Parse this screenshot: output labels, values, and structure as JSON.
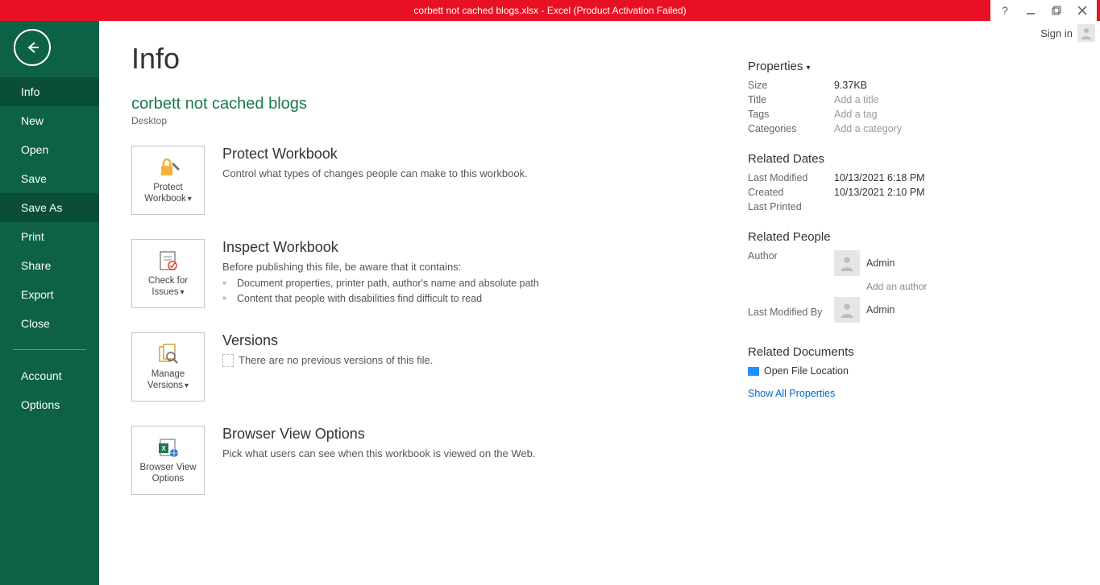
{
  "titlebar": {
    "title": "corbett not cached blogs.xlsx -  Excel (Product Activation Failed)"
  },
  "signin": {
    "label": "Sign in"
  },
  "sidebar": {
    "items": [
      "Info",
      "New",
      "Open",
      "Save",
      "Save As",
      "Print",
      "Share",
      "Export",
      "Close"
    ],
    "extra": [
      "Account",
      "Options"
    ]
  },
  "page": {
    "heading": "Info",
    "docname": "corbett not cached blogs",
    "doclocation": "Desktop"
  },
  "tiles": {
    "protect": {
      "label": "Protect Workbook"
    },
    "check": {
      "label": "Check for Issues"
    },
    "manage": {
      "label": "Manage Versions"
    },
    "browser": {
      "label": "Browser View Options"
    }
  },
  "sections": {
    "protect": {
      "title": "Protect Workbook",
      "desc": "Control what types of changes people can make to this workbook."
    },
    "inspect": {
      "title": "Inspect Workbook",
      "desc": "Before publishing this file, be aware that it contains:",
      "items": [
        "Document properties, printer path, author's name and absolute path",
        "Content that people with disabilities find difficult to read"
      ]
    },
    "versions": {
      "title": "Versions",
      "desc": "There are no previous versions of this file."
    },
    "browser": {
      "title": "Browser View Options",
      "desc": "Pick what users can see when this workbook is viewed on the Web."
    }
  },
  "properties": {
    "heading": "Properties",
    "rows": {
      "size": {
        "k": "Size",
        "v": "9.37KB"
      },
      "title": {
        "k": "Title",
        "v": "Add a title",
        "ph": true
      },
      "tags": {
        "k": "Tags",
        "v": "Add a tag",
        "ph": true
      },
      "categories": {
        "k": "Categories",
        "v": "Add a category",
        "ph": true
      }
    },
    "dates": {
      "heading": "Related Dates",
      "lastmod": {
        "k": "Last Modified",
        "v": "10/13/2021 6:18 PM"
      },
      "created": {
        "k": "Created",
        "v": "10/13/2021 2:10 PM"
      },
      "lastprint": {
        "k": "Last Printed",
        "v": ""
      }
    },
    "people": {
      "heading": "Related People",
      "author": {
        "k": "Author",
        "v": "Admin",
        "add": "Add an author"
      },
      "modby": {
        "k": "Last Modified By",
        "v": "Admin"
      }
    },
    "docs": {
      "heading": "Related Documents",
      "open": "Open File Location",
      "showall": "Show All Properties"
    }
  }
}
